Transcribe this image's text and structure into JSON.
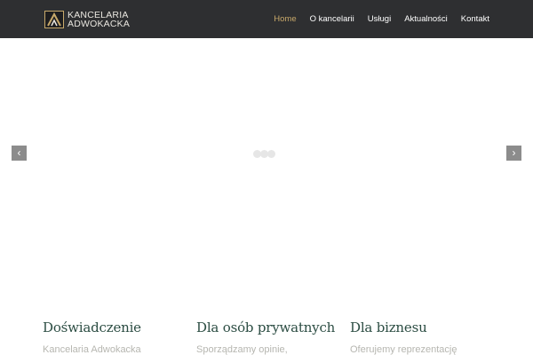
{
  "header": {
    "logo": {
      "line1": "KANCELARIA",
      "line2": "ADWOKACKA",
      "icon": "logo-icon"
    },
    "nav": [
      {
        "label": "Home",
        "active": true
      },
      {
        "label": "O kancelarii",
        "active": false
      },
      {
        "label": "Usługi",
        "active": false
      },
      {
        "label": "Aktualności",
        "active": false
      },
      {
        "label": "Kontakt",
        "active": false
      }
    ]
  },
  "slider": {
    "prev_icon": "‹",
    "next_icon": "›"
  },
  "features": [
    {
      "title": "Doświadczenie",
      "text": "Kancelaria Adwokacka"
    },
    {
      "title": "Dla osób prywatnych",
      "text": "Sporządzamy opinie,"
    },
    {
      "title": "Dla biznesu",
      "text": "Oferujemy reprezentację"
    }
  ],
  "colors": {
    "header_bg": "#2e2f31",
    "accent": "#c8a96a",
    "heading": "#2c4d43",
    "muted_text": "#b6b6b0"
  }
}
